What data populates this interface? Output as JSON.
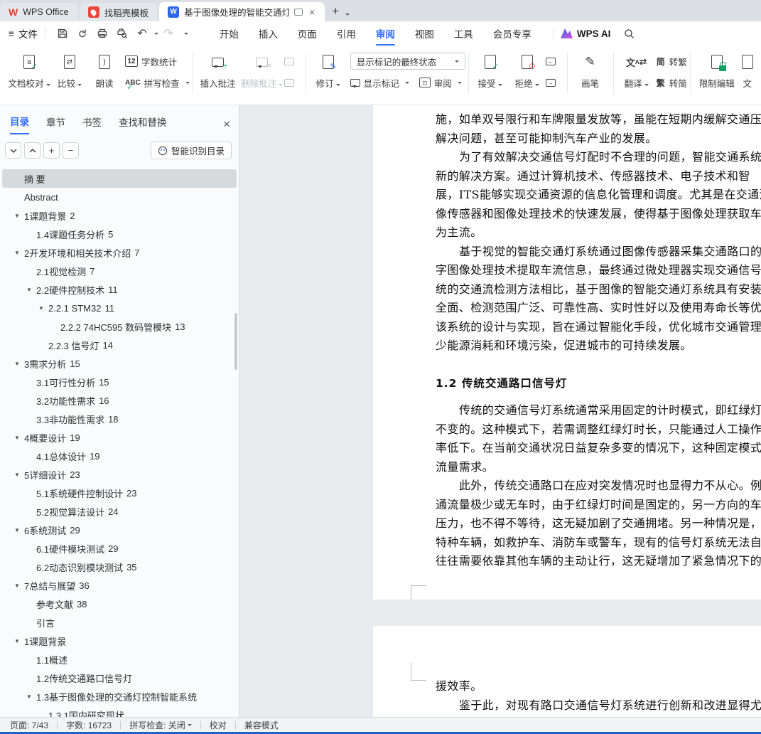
{
  "colors": {
    "accent_blue": "#3370ff",
    "wps_red": "#e3402f",
    "word_blue": "#2f66e8",
    "ok_green": "#1faf63",
    "reject_red": "#e23c39",
    "lock_green": "#12a364"
  },
  "tabbar": {
    "tabs": [
      {
        "label": "WPS Office"
      },
      {
        "label": "找稻壳模板"
      },
      {
        "label": "基于图像处理的智能交通灯控"
      }
    ]
  },
  "menubar": {
    "file": "文件",
    "tabs": [
      "开始",
      "插入",
      "页面",
      "引用",
      "审阅",
      "视图",
      "工具",
      "会员专享"
    ],
    "active_tab": "审阅",
    "ai_label": "WPS AI"
  },
  "ribbon": {
    "proof": {
      "doc_check": "文档校对",
      "compare": "比较",
      "read": "朗读",
      "word_count": "字数统计",
      "spell": "拼写检查"
    },
    "comments": {
      "insert": "插入批注",
      "delete": "删除批注"
    },
    "track": {
      "revise": "修订",
      "state_select": "显示标记的最终状态",
      "show_markup": "显示标记",
      "review": "审阅"
    },
    "changes": {
      "accept": "接受",
      "reject": "拒绝"
    },
    "draw": {
      "brush": "画笔"
    },
    "translate": {
      "translate": "翻译",
      "trad_prefix": "简",
      "to_trad": "转繁",
      "simp_prefix": "繁",
      "to_simp": "转简"
    },
    "protect": {
      "restrict": "限制编辑",
      "clipped": "文"
    }
  },
  "sidebar": {
    "tabs": [
      "目录",
      "章节",
      "书签",
      "查找和替换"
    ],
    "active_tab": "目录",
    "smart_toc": "智能识别目录",
    "toc": [
      {
        "label": "摘 要",
        "page": "",
        "level": 0,
        "arrow": false,
        "selected": true
      },
      {
        "label": "Abstract",
        "page": "",
        "level": 0,
        "arrow": false
      },
      {
        "label": "1课题背景",
        "page": "2",
        "level": 0,
        "arrow": true
      },
      {
        "label": "1.4课题任务分析",
        "page": "5",
        "level": 1,
        "arrow": false
      },
      {
        "label": "2开发环境和相关技术介绍",
        "page": "7",
        "level": 0,
        "arrow": true
      },
      {
        "label": "2.1视觉检测",
        "page": "7",
        "level": 1,
        "arrow": false
      },
      {
        "label": "2.2硬件控制技术",
        "page": "11",
        "level": 1,
        "arrow": true
      },
      {
        "label": "2.2.1 STM32",
        "page": "11",
        "level": 2,
        "arrow": true
      },
      {
        "label": "2.2.2 74HC595 数码管模块",
        "page": "13",
        "level": 3,
        "arrow": false
      },
      {
        "label": "2.2.3 信号灯",
        "page": "14",
        "level": 2,
        "arrow": false
      },
      {
        "label": "3需求分析",
        "page": "15",
        "level": 0,
        "arrow": true
      },
      {
        "label": "3.1可行性分析",
        "page": "15",
        "level": 1,
        "arrow": false
      },
      {
        "label": "3.2功能性需求",
        "page": "16",
        "level": 1,
        "arrow": false
      },
      {
        "label": "3.3非功能性需求",
        "page": "18",
        "level": 1,
        "arrow": false
      },
      {
        "label": "4概要设计",
        "page": "19",
        "level": 0,
        "arrow": true
      },
      {
        "label": "4.1总体设计",
        "page": "19",
        "level": 1,
        "arrow": false
      },
      {
        "label": "5详细设计",
        "page": "23",
        "level": 0,
        "arrow": true
      },
      {
        "label": "5.1系统硬件控制设计",
        "page": "23",
        "level": 1,
        "arrow": false
      },
      {
        "label": "5.2视觉算法设计",
        "page": "24",
        "level": 1,
        "arrow": false
      },
      {
        "label": "6系统测试",
        "page": "29",
        "level": 0,
        "arrow": true
      },
      {
        "label": "6.1硬件模块测试",
        "page": "29",
        "level": 1,
        "arrow": false
      },
      {
        "label": "6.2动态识别模块测试",
        "page": "35",
        "level": 1,
        "arrow": false
      },
      {
        "label": "7总结与展望",
        "page": "36",
        "level": 0,
        "arrow": true
      },
      {
        "label": "参考文献",
        "page": "38",
        "level": 1,
        "arrow": false
      },
      {
        "label": "引言",
        "page": "",
        "level": 1,
        "arrow": false
      },
      {
        "label": "1课题背景",
        "page": "",
        "level": 0,
        "arrow": true
      },
      {
        "label": "1.1概述",
        "page": "",
        "level": 1,
        "arrow": false
      },
      {
        "label": "1.2传统交通路口信号灯",
        "page": "",
        "level": 1,
        "arrow": false
      },
      {
        "label": "1.3基于图像处理的交通灯控制智能系统",
        "page": "",
        "level": 1,
        "arrow": true
      },
      {
        "label": "1.3.1国内研究现状",
        "page": "",
        "level": 2,
        "arrow": false
      }
    ]
  },
  "document": {
    "page1_lines": [
      {
        "text": "施，如单双号限行和车牌限量发放等，虽能在短期内缓解交通压"
      },
      {
        "text": "解决问题，甚至可能抑制汽车产业的发展。"
      },
      {
        "text": "为了有效解决交通信号灯配时不合理的问题，智能交通系统",
        "indent": true
      },
      {
        "text": "新的解决方案。通过计算机技术、传感器技术、电子技术和智"
      },
      {
        "text": "展，ITS能够实现交通资源的信息化管理和调度。尤其是在交通流"
      },
      {
        "text": "像传感器和图像处理技术的快速发展，使得基于图像处理获取车"
      },
      {
        "text": "为主流。"
      },
      {
        "text": "基于视觉的智能交通灯系统通过图像传感器采集交通路口的",
        "indent": true
      },
      {
        "text": "字图像处理技术提取车流信息，最终通过微处理器实现交通信号"
      },
      {
        "text": "统的交通流检测方法相比，基于图像的智能交通灯系统具有安装"
      },
      {
        "text": "全面、检测范围广泛、可靠性高、实时性好以及使用寿命长等优"
      },
      {
        "text": "该系统的设计与实现，旨在通过智能化手段，优化城市交通管理"
      },
      {
        "text": "少能源消耗和环境污染，促进城市的可持续发展。"
      },
      {
        "text": "1.2 传统交通路口信号灯",
        "heading": true
      },
      {
        "text": "传统的交通信号灯系统通常采用固定的计时模式，即红绿灯",
        "indent": true
      },
      {
        "text": "不变的。这种模式下，若需调整红绿灯时长，只能通过人工操作"
      },
      {
        "text": "率低下。在当前交通状况日益复杂多变的情况下，这种固定模式"
      },
      {
        "text": "流量需求。"
      },
      {
        "text": "此外，传统交通路口在应对突发情况时也显得力不从心。例",
        "indent": true
      },
      {
        "text": "通流量极少或无车时，由于红绿灯时间是固定的，另一方向的车"
      },
      {
        "text": "压力，也不得不等待，这无疑加剧了交通拥堵。另一种情况是，"
      },
      {
        "text": "特种车辆，如救护车、消防车或警车，现有的信号灯系统无法自"
      },
      {
        "text": "往往需要依靠其他车辆的主动让行，这无疑增加了紧急情况下的"
      }
    ],
    "page2_lines": [
      {
        "text": "援效率。"
      },
      {
        "text": "鉴于此，对现有路口交通信号灯系统进行创新和改进显得尤",
        "indent": true
      }
    ]
  },
  "statusbar": {
    "page": "页面: 7/43",
    "words": "字数: 16723",
    "spell": "拼写检查: 关闭",
    "proof": "校对",
    "mode": "兼容模式"
  }
}
